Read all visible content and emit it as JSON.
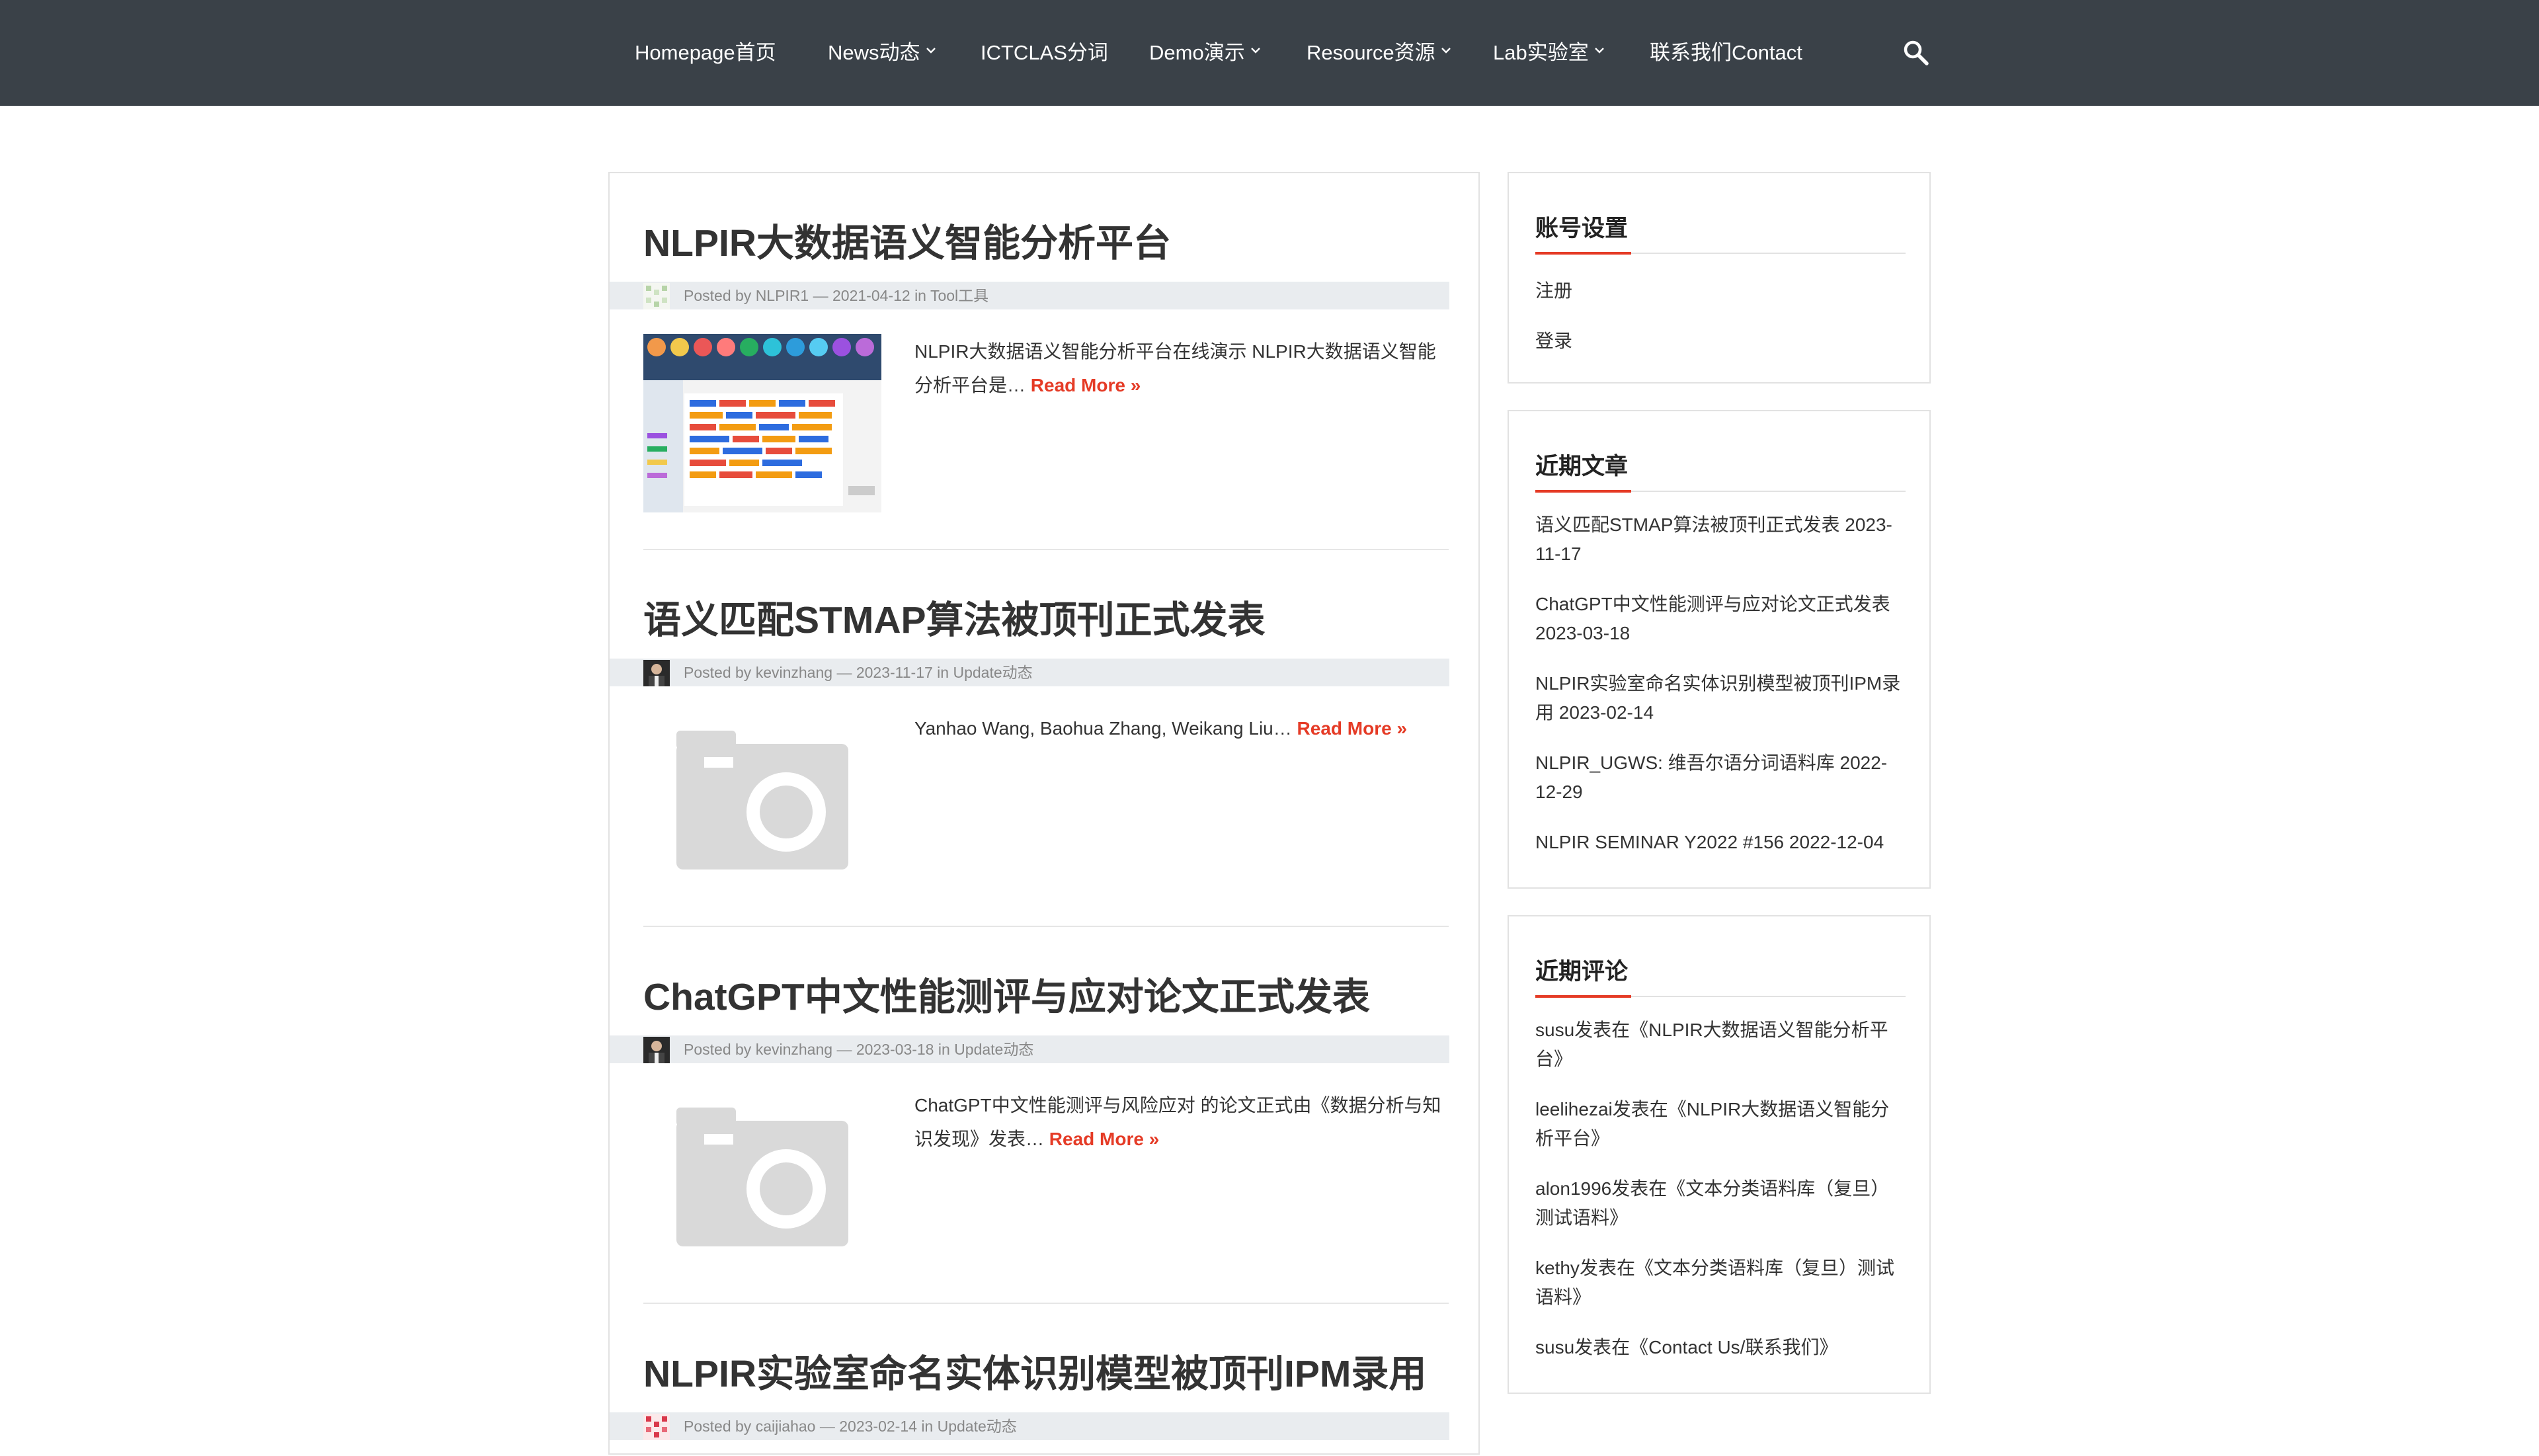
{
  "nav": {
    "items": [
      {
        "label": "Homepage首页",
        "has_dropdown": false
      },
      {
        "label": "News动态",
        "has_dropdown": true
      },
      {
        "label": "ICTCLAS分词",
        "has_dropdown": false
      },
      {
        "label": "Demo演示",
        "has_dropdown": true
      },
      {
        "label": "Resource资源",
        "has_dropdown": true
      },
      {
        "label": "Lab实验室",
        "has_dropdown": true
      },
      {
        "label": "联系我们Contact",
        "has_dropdown": false
      }
    ],
    "search_icon": "search-icon"
  },
  "posts": [
    {
      "title": "NLPIR大数据语义智能分析平台",
      "meta": {
        "posted_by": "Posted by",
        "author": "NLPIR1",
        "sep": "—",
        "date": "2021-04-12",
        "in": "in",
        "category": "Tool工具"
      },
      "excerpt": "NLPIR大数据语义智能分析平台在线演示 NLPIR大数据语义智能分析平台是…",
      "read_more": "Read More »",
      "thumb": "platform-screenshot"
    },
    {
      "title": "语义匹配STMAP算法被顶刊正式发表",
      "meta": {
        "posted_by": "Posted by",
        "author": "kevinzhang",
        "sep": "—",
        "date": "2023-11-17",
        "in": "in",
        "category": "Update动态"
      },
      "excerpt": "Yanhao Wang, Baohua Zhang, Weikang Liu…",
      "read_more": "Read More »",
      "thumb": "camera-placeholder"
    },
    {
      "title": "ChatGPT中文性能测评与应对论文正式发表",
      "meta": {
        "posted_by": "Posted by",
        "author": "kevinzhang",
        "sep": "—",
        "date": "2023-03-18",
        "in": "in",
        "category": "Update动态"
      },
      "excerpt": "ChatGPT中文性能测评与风险应对 的论文正式由《数据分析与知识发现》发表…",
      "read_more": "Read More »",
      "thumb": "camera-placeholder"
    },
    {
      "title": "NLPIR实验室命名实体识别模型被顶刊IPM录用",
      "meta": {
        "posted_by": "Posted by",
        "author": "caijiahao",
        "sep": "—",
        "date": "2023-02-14",
        "in": "in",
        "category": "Update动态"
      },
      "excerpt": "",
      "read_more": "",
      "thumb": ""
    }
  ],
  "sidebar": {
    "account": {
      "title": "账号设置",
      "items": [
        "注册",
        "登录"
      ]
    },
    "recent_posts": {
      "title": "近期文章",
      "items": [
        {
          "text": "语义匹配STMAP算法被顶刊正式发表",
          "date": "2023-11-17"
        },
        {
          "text": "ChatGPT中文性能测评与应对论文正式发表",
          "date": "2023-03-18"
        },
        {
          "text": "NLPIR实验室命名实体识别模型被顶刊IPM录用",
          "date": "2023-02-14"
        },
        {
          "text": "NLPIR_UGWS: 维吾尔语分词语料库",
          "date": "2022-12-29"
        },
        {
          "text": "NLPIR SEMINAR Y2022 #156",
          "date": "2022-12-04"
        }
      ]
    },
    "recent_comments": {
      "title": "近期评论",
      "items": [
        {
          "author": "susu",
          "on": "发表在",
          "post": "《NLPIR大数据语义智能分析平台》"
        },
        {
          "author": "leelihezai",
          "on": "发表在",
          "post": "《NLPIR大数据语义智能分析平台》"
        },
        {
          "author": "alon1996",
          "on": "发表在",
          "post": "《文本分类语料库（复旦）测试语料》"
        },
        {
          "author": "kethy",
          "on": "发表在",
          "post": "《文本分类语料库（复旦）测试语料》"
        },
        {
          "author": "susu",
          "on": "发表在",
          "post": "《Contact Us/联系我们》"
        }
      ]
    }
  },
  "colors": {
    "nav_bg": "#3a4148",
    "accent": "#e53b26",
    "meta_bg": "#e9ecef"
  }
}
